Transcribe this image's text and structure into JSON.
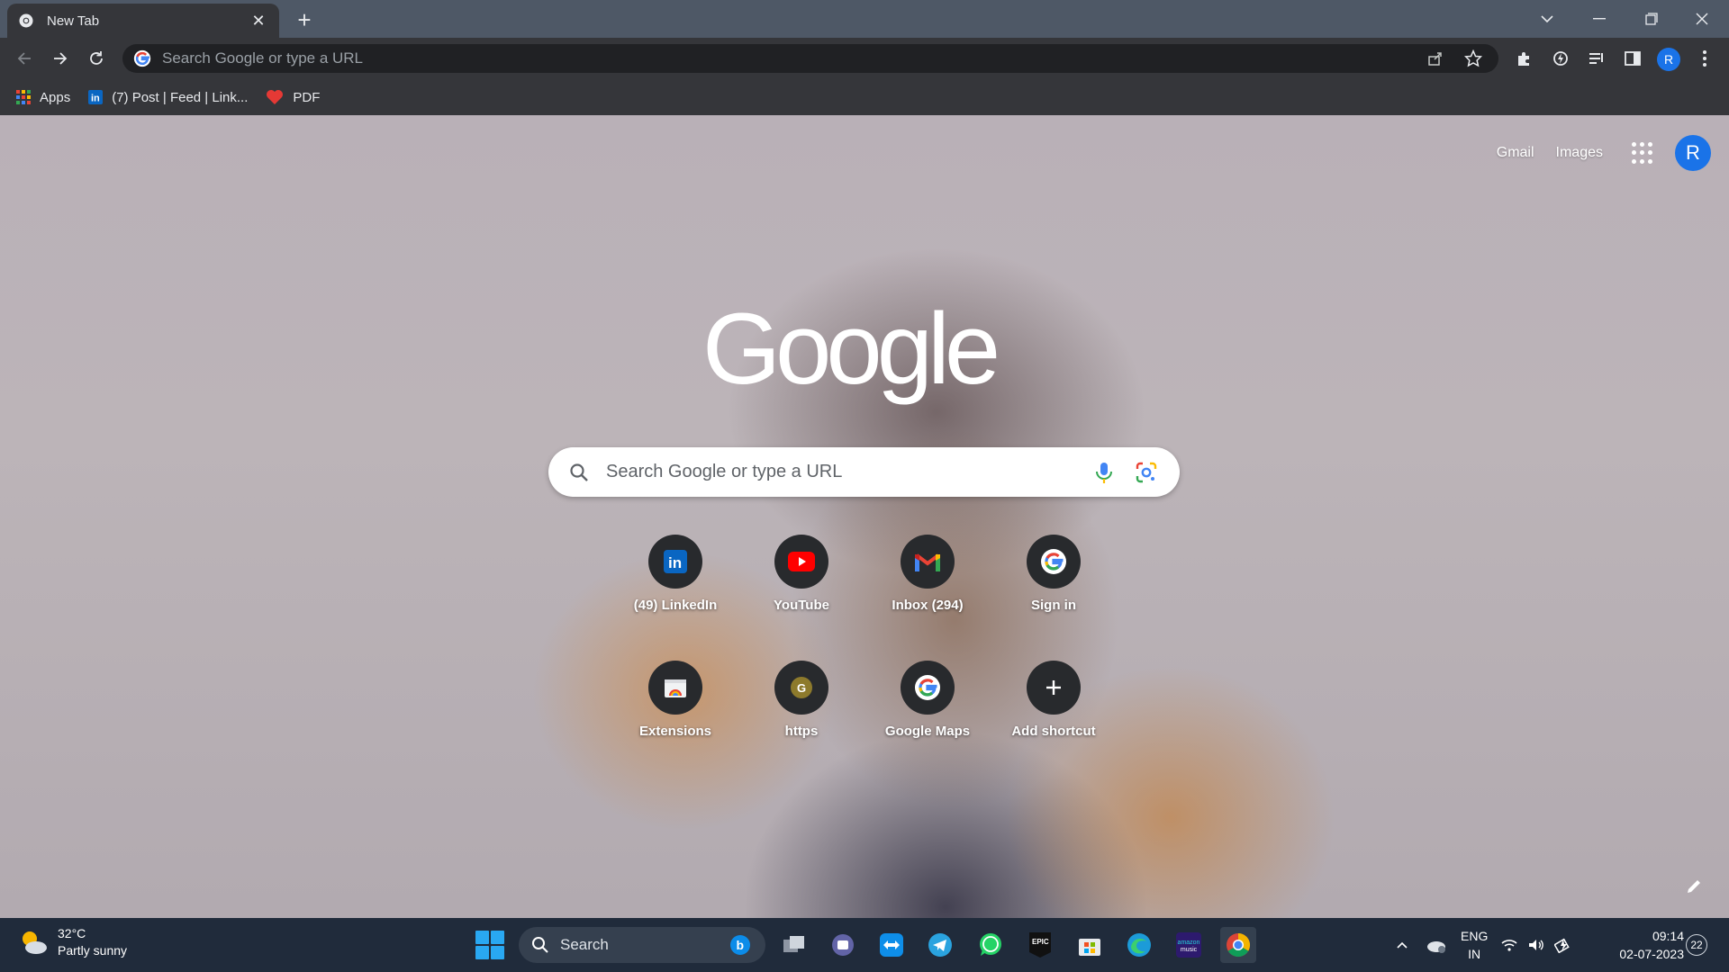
{
  "browser": {
    "tab": {
      "title": "New Tab",
      "close_icon": "close-icon"
    },
    "new_tab_icon": "plus-icon",
    "window_controls": [
      "chevron-down-icon",
      "minimize-icon",
      "restore-icon",
      "close-icon"
    ]
  },
  "toolbar": {
    "omnibox_placeholder": "Search Google or type a URL",
    "profile_initial": "R"
  },
  "bookmarks": [
    {
      "label": "Apps",
      "icon": "apps-grid-icon"
    },
    {
      "label": "(7) Post | Feed | Link...",
      "icon": "linkedin-icon"
    },
    {
      "label": "PDF",
      "icon": "heart-icon"
    }
  ],
  "ntp": {
    "top_links": {
      "gmail": "Gmail",
      "images": "Images"
    },
    "profile_initial": "R",
    "logo_text": "Google",
    "search_placeholder": "Search Google or type a URL",
    "shortcuts": [
      {
        "label": "(49) LinkedIn",
        "icon": "linkedin-icon"
      },
      {
        "label": "YouTube",
        "icon": "youtube-icon"
      },
      {
        "label": "Inbox (294)",
        "icon": "gmail-icon"
      },
      {
        "label": "Sign in",
        "icon": "google-icon"
      },
      {
        "label": "Extensions",
        "icon": "chrome-web-store-icon"
      },
      {
        "label": "https",
        "icon": "letter-g-icon",
        "letter": "G"
      },
      {
        "label": "Google Maps",
        "icon": "google-icon"
      },
      {
        "label": "Add shortcut",
        "icon": "plus-icon"
      }
    ]
  },
  "taskbar": {
    "weather": {
      "temp": "32°C",
      "condition": "Partly sunny"
    },
    "search_placeholder": "Search",
    "language": {
      "line1": "ENG",
      "line2": "IN"
    },
    "clock": {
      "time": "09:14",
      "date": "02-07-2023"
    },
    "notifications": "22"
  }
}
